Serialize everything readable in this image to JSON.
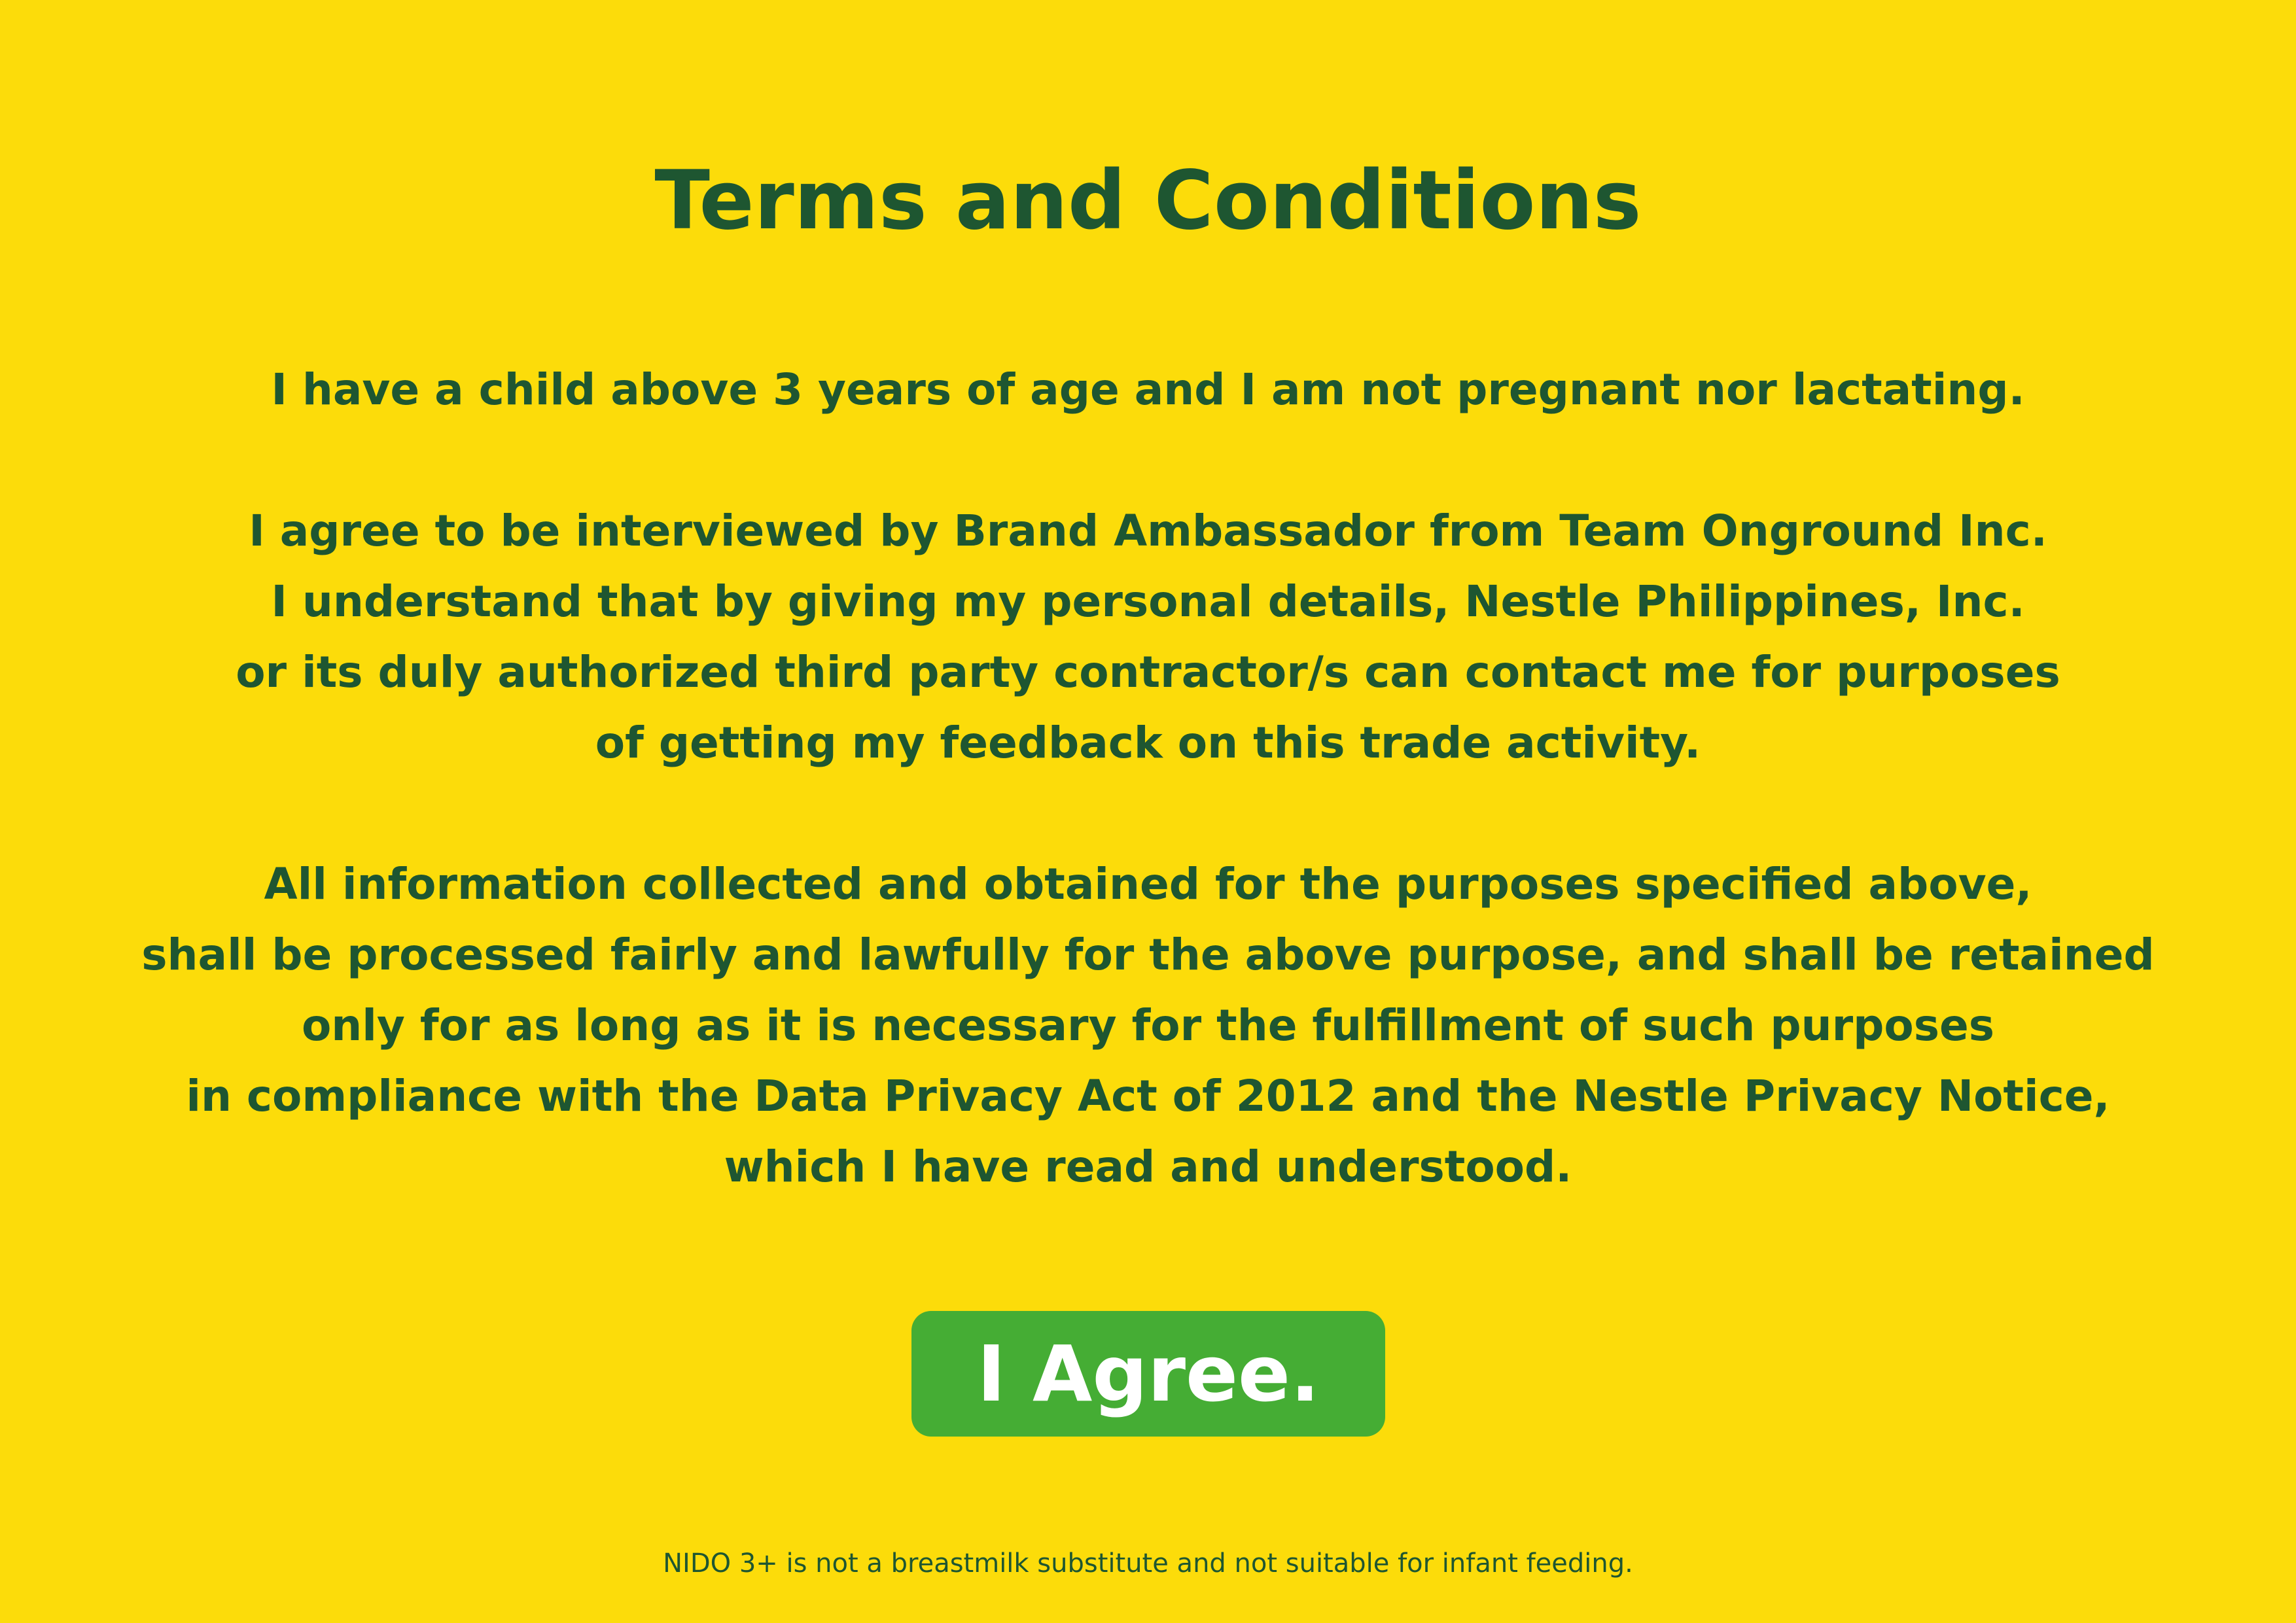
{
  "title": "Terms and Conditions",
  "paragraphs": [
    {
      "lines": [
        "I have a child above 3 years of age and I am not pregnant nor lactating."
      ]
    },
    {
      "lines": [
        "I agree to be interviewed by Brand Ambassador from Team Onground Inc.",
        "I understand that by giving my personal details, Nestle Philippines, Inc.",
        "or its duly authorized third party contractor/s can contact me for purposes",
        "of getting my feedback on this trade activity."
      ]
    },
    {
      "lines": [
        "All information collected and obtained for the purposes specified above,",
        "shall be processed fairly and lawfully for the above purpose, and shall be retained",
        "only for as long as it is necessary for the fulfillment of such purposes",
        "in compliance with the Data Privacy Act of 2012 and the Nestle Privacy Notice,",
        "which I have read and understood."
      ]
    }
  ],
  "agree_button": {
    "label": "I Agree."
  },
  "disclaimer": "NIDO 3+ is not a breastmilk substitute and not suitable for infant feeding.",
  "colors": {
    "background": "#FCDC0A",
    "text": "#1E5631",
    "button": "#45AD34",
    "button_text": "#FFFFFF"
  }
}
